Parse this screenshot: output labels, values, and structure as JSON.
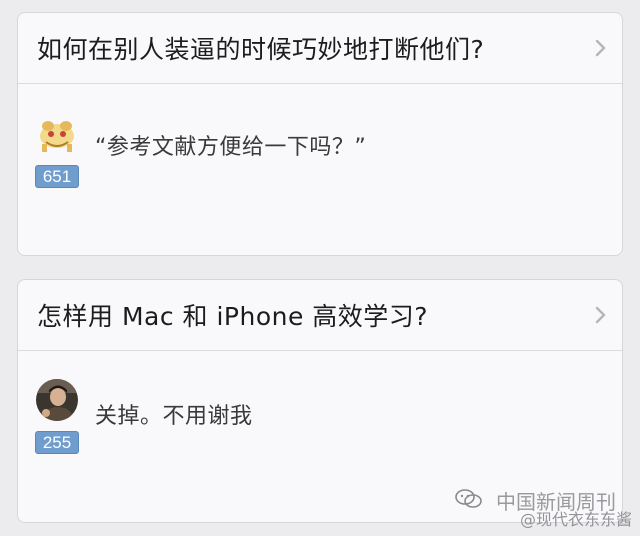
{
  "cards": [
    {
      "question": "如何在别人装逼的时候巧妙地打断他们?",
      "answer_excerpt": "“参考文献方便给一下吗？”",
      "votes": "651",
      "avatar_icon": "cartoon-avatar-icon"
    },
    {
      "question": "怎样用 Mac 和 iPhone 高效学习?",
      "answer_excerpt": "关掉。不用谢我",
      "votes": "255",
      "avatar_icon": "user-photo-avatar-icon"
    }
  ],
  "watermark": {
    "line1": "中国新闻周刊",
    "line2": "@现代衣东东酱"
  },
  "colors": {
    "vote_badge": "#6f9dce",
    "background": "#ececef",
    "card": "#f9f9fb"
  }
}
